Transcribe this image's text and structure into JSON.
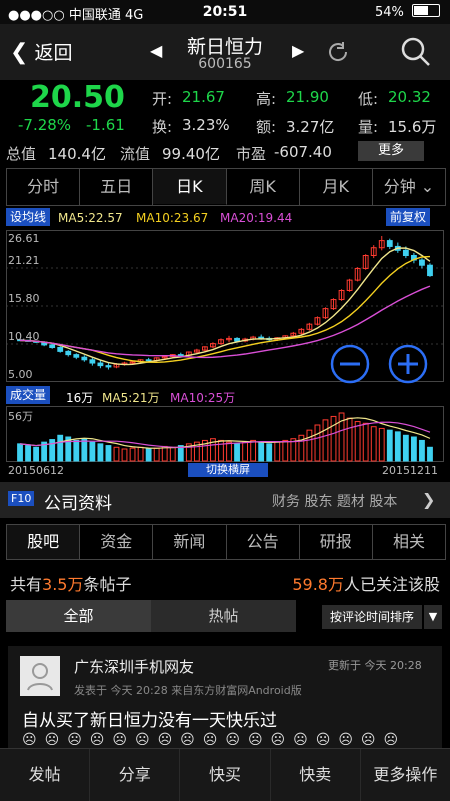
{
  "status": {
    "carrier": "●●●○○ 中国联通  4G",
    "time": "20:51",
    "battery": "54%",
    "battery_level": 0.54
  },
  "nav": {
    "back": "返回",
    "prev": "◀",
    "next": "▶",
    "title": "新日恒力",
    "code": "600165"
  },
  "quote": {
    "price": "20.50",
    "pct": "-7.28%",
    "chg": "-1.61",
    "open_l": "开:",
    "open": "21.67",
    "high_l": "高:",
    "high": "21.90",
    "low_l": "低:",
    "low": "20.32",
    "turn_l": "换:",
    "turn": "3.23%",
    "amt_l": "额:",
    "amt": "3.27亿",
    "vol_l": "量:",
    "vol": "15.6万",
    "mcap_l": "总值",
    "mcap": "140.4亿",
    "float_l": "流值",
    "float": "99.40亿",
    "pe_l": "市盈",
    "pe": "-607.40",
    "more": "更多"
  },
  "ktabs": [
    "分时",
    "五日",
    "日K",
    "周K",
    "月K",
    "分钟"
  ],
  "kline": {
    "ma_btn": "设均线",
    "ma5": "MA5:22.57",
    "ma10": "MA10:23.67",
    "ma20": "MA20:19.44",
    "adj_btn": "前复权",
    "y_labels": [
      "26.61",
      "21.21",
      "15.80",
      "10.40",
      "5.00"
    ],
    "vol_btn": "成交量",
    "vol_val": "16万",
    "vol_ma5": "MA5:21万",
    "vol_ma10": "MA10:25万",
    "vol_max": "56万",
    "date_start": "20150612",
    "date_end": "20151211",
    "landscape": "切换横屏"
  },
  "chart_data": {
    "type": "candlestick",
    "ylim": [
      5.0,
      26.61
    ],
    "candles": [
      [
        10.6,
        10.7,
        10.4,
        10.5
      ],
      [
        10.5,
        10.6,
        10.3,
        10.4
      ],
      [
        10.4,
        10.5,
        10.1,
        10.2
      ],
      [
        10.2,
        10.4,
        9.6,
        9.8
      ],
      [
        9.8,
        10.0,
        9.2,
        9.4
      ],
      [
        9.4,
        9.6,
        8.6,
        8.8
      ],
      [
        8.8,
        9.0,
        8.0,
        8.3
      ],
      [
        8.3,
        8.5,
        7.6,
        7.9
      ],
      [
        7.9,
        8.2,
        7.2,
        7.5
      ],
      [
        7.5,
        7.8,
        6.6,
        7.0
      ],
      [
        7.0,
        7.4,
        6.2,
        6.6
      ],
      [
        6.6,
        7.0,
        6.0,
        6.4
      ],
      [
        6.4,
        7.0,
        6.2,
        6.8
      ],
      [
        6.8,
        7.2,
        6.6,
        7.0
      ],
      [
        7.0,
        7.4,
        6.8,
        7.2
      ],
      [
        7.2,
        7.6,
        7.0,
        7.5
      ],
      [
        7.5,
        7.8,
        7.2,
        7.4
      ],
      [
        7.4,
        7.9,
        7.2,
        7.8
      ],
      [
        7.8,
        8.2,
        7.6,
        8.0
      ],
      [
        8.0,
        8.4,
        7.8,
        8.3
      ],
      [
        8.3,
        8.6,
        8.0,
        8.2
      ],
      [
        8.2,
        8.8,
        8.0,
        8.7
      ],
      [
        8.7,
        9.2,
        8.5,
        9.0
      ],
      [
        9.0,
        9.6,
        8.8,
        9.5
      ],
      [
        9.5,
        10.2,
        9.3,
        10.0
      ],
      [
        10.0,
        10.8,
        9.8,
        10.6
      ],
      [
        10.6,
        11.2,
        10.2,
        10.8
      ],
      [
        10.8,
        11.0,
        10.2,
        10.4
      ],
      [
        10.4,
        10.9,
        10.2,
        10.7
      ],
      [
        10.7,
        11.2,
        10.5,
        11.0
      ],
      [
        11.0,
        11.4,
        10.6,
        10.8
      ],
      [
        10.8,
        11.1,
        10.4,
        10.6
      ],
      [
        10.6,
        11.0,
        10.4,
        10.9
      ],
      [
        10.9,
        11.3,
        10.7,
        11.2
      ],
      [
        11.2,
        11.8,
        11.0,
        11.6
      ],
      [
        11.6,
        12.4,
        11.4,
        12.2
      ],
      [
        12.2,
        13.2,
        12.0,
        13.0
      ],
      [
        13.0,
        14.2,
        12.8,
        14.0
      ],
      [
        14.0,
        15.6,
        13.8,
        15.4
      ],
      [
        15.4,
        17.0,
        15.2,
        16.8
      ],
      [
        16.8,
        18.4,
        16.6,
        18.2
      ],
      [
        18.2,
        20.0,
        18.0,
        19.8
      ],
      [
        19.8,
        21.8,
        19.6,
        21.6
      ],
      [
        21.6,
        23.8,
        21.4,
        23.6
      ],
      [
        23.6,
        25.2,
        23.2,
        24.8
      ],
      [
        24.8,
        26.61,
        24.4,
        25.9
      ],
      [
        25.9,
        26.2,
        24.6,
        25.0
      ],
      [
        25.0,
        25.6,
        24.0,
        24.4
      ],
      [
        24.4,
        25.0,
        23.2,
        23.6
      ],
      [
        23.6,
        24.0,
        22.4,
        22.9
      ],
      [
        22.9,
        23.2,
        21.6,
        22.1
      ],
      [
        22.1,
        22.4,
        20.3,
        20.5
      ]
    ],
    "volumes": [
      20,
      18,
      16,
      22,
      25,
      30,
      28,
      24,
      26,
      22,
      20,
      18,
      16,
      14,
      15,
      16,
      14,
      15,
      17,
      16,
      18,
      20,
      22,
      24,
      26,
      24,
      22,
      20,
      22,
      24,
      22,
      20,
      22,
      24,
      26,
      30,
      36,
      42,
      48,
      52,
      56,
      50,
      46,
      44,
      40,
      38,
      36,
      34,
      30,
      28,
      24,
      16
    ]
  },
  "f10": {
    "badge": "F10",
    "title": "公司资料",
    "links": "财务 股东 题材 股本",
    "arrow": "❯"
  },
  "subtabs": [
    "股吧",
    "资金",
    "新闻",
    "公告",
    "研报",
    "相关"
  ],
  "stats": {
    "posts_pre": "共有",
    "posts_num": "3.5万",
    "posts_post": "条帖子",
    "follow_num": "59.8万",
    "follow_post": "人已关注该股"
  },
  "filter": {
    "tabs": [
      "全部",
      "热帖"
    ],
    "sort": "按评论时间排序",
    "sort_arrow": "▼"
  },
  "post": {
    "user": "广东深圳手机网友",
    "updated": "更新于 今天 20:28",
    "meta": "发表于 今天 20:28  来自东方财富网Android版",
    "text": "自从买了新日恒力没有一天快乐过",
    "emoji_row": "☹☹☹☹☹☹☹☹☹☹☹☹☹☹☹☹☹"
  },
  "bottom": [
    "发帖",
    "分享",
    "快买",
    "快卖",
    "更多操作"
  ]
}
